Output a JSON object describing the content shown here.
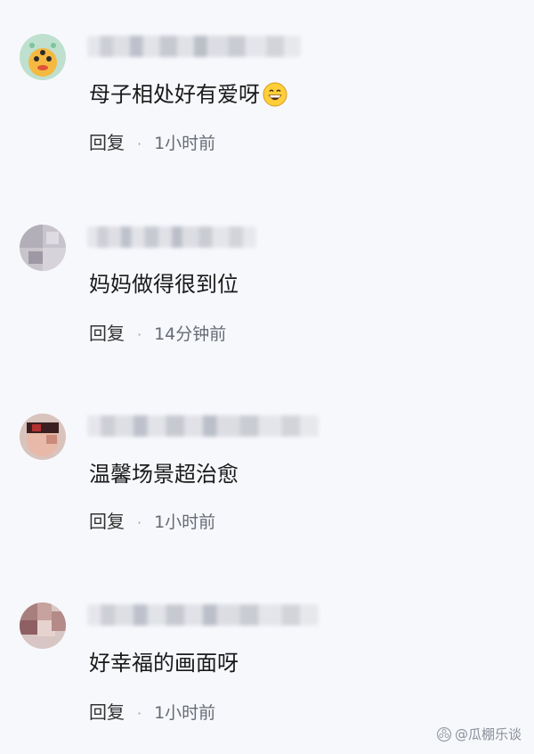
{
  "comments": [
    {
      "text": "母子相处好有爱呀",
      "reply_label": "回复",
      "separator": "·",
      "time": "1小时前",
      "has_emoji": true,
      "emoji": "grinning-face"
    },
    {
      "text": "妈妈做得很到位",
      "reply_label": "回复",
      "separator": "·",
      "time": "14分钟前",
      "has_emoji": false
    },
    {
      "text": "温馨场景超治愈",
      "reply_label": "回复",
      "separator": "·",
      "time": "1小时前",
      "has_emoji": false
    },
    {
      "text": "好幸福的画面呀",
      "reply_label": "回复",
      "separator": "·",
      "time": "1小时前",
      "has_emoji": false
    }
  ],
  "watermark": {
    "text": "@瓜棚乐谈",
    "icon": "camera-flower-icon"
  },
  "colors": {
    "background": "#f7f8fc",
    "meta_text": "#555a63"
  }
}
